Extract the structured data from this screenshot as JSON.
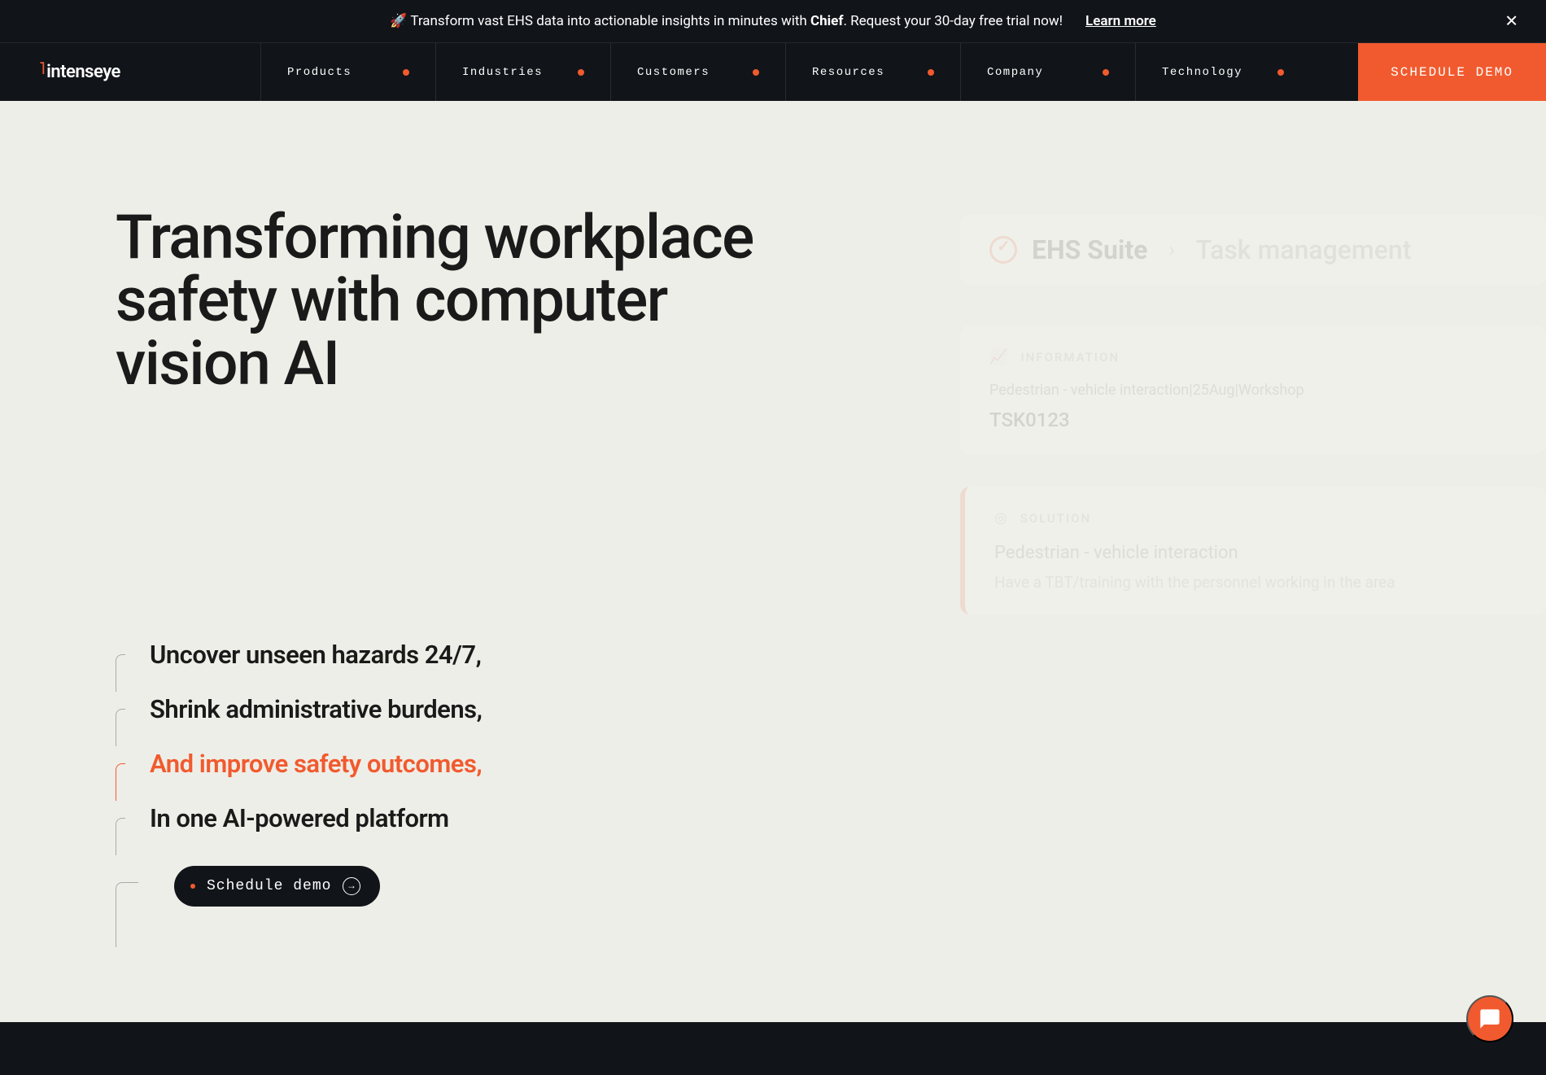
{
  "announcement": {
    "emoji": "🚀",
    "text_before": "Transform vast EHS data into actionable insights in minutes with ",
    "text_bold": "Chief",
    "text_after": ". Request your 30-day free trial now!",
    "cta": "Learn more"
  },
  "logo": {
    "mark": "˥",
    "text": "intenseye"
  },
  "nav": {
    "items": [
      {
        "label": "Products"
      },
      {
        "label": "Industries"
      },
      {
        "label": "Customers"
      },
      {
        "label": "Resources"
      },
      {
        "label": "Company"
      },
      {
        "label": "Technology"
      }
    ],
    "cta": "SCHEDULE DEMO"
  },
  "hero": {
    "title": "Transforming workplace safety with computer vision AI",
    "benefits": [
      {
        "text": "Uncover unseen hazards 24/7,",
        "active": false
      },
      {
        "text": "Shrink administrative burdens,",
        "active": false
      },
      {
        "text": "And improve safety outcomes,",
        "active": true
      },
      {
        "text": "In one AI-powered platform",
        "active": false
      }
    ],
    "schedule_btn": "Schedule demo"
  },
  "widget": {
    "title": "EHS Suite",
    "subtitle": "Task management",
    "info_card": {
      "label": "INFORMATION",
      "line1": "Pedestrian - vehicle interaction|25Aug|Workshop",
      "line2": "TSK0123"
    },
    "solution_card": {
      "label": "SOLUTION",
      "title": "Pedestrian - vehicle interaction",
      "text": "Have a TBT/training with the personnel working in the area"
    }
  }
}
